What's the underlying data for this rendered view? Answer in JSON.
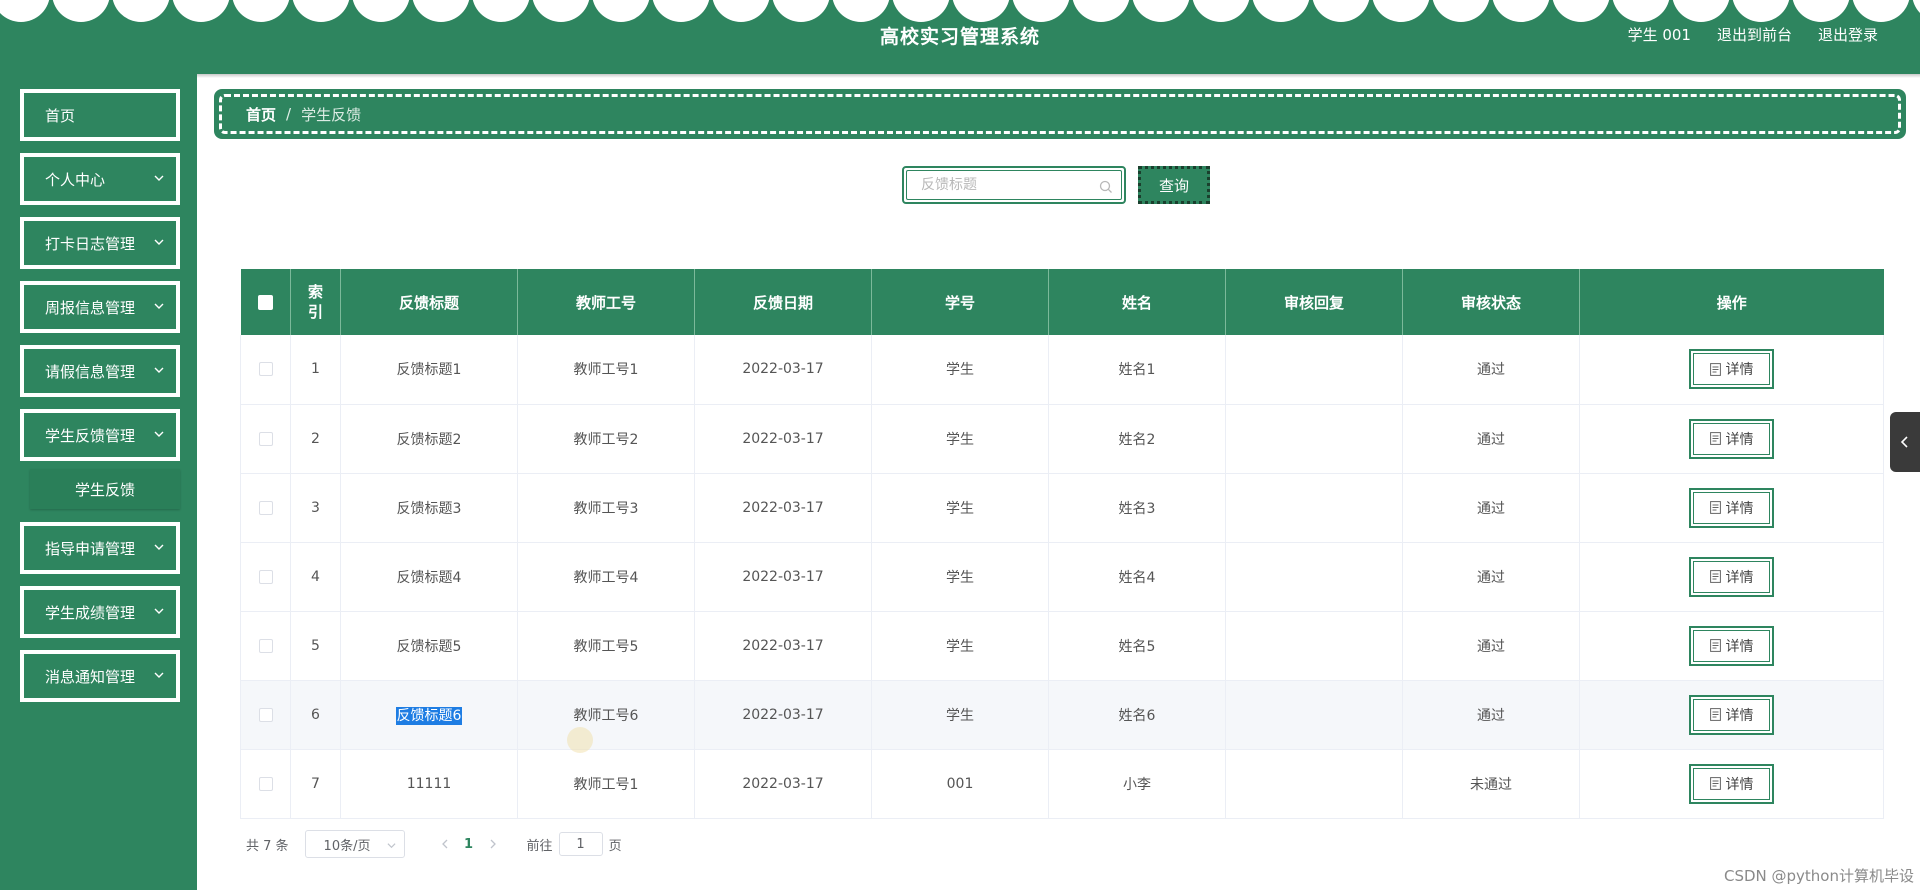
{
  "header": {
    "title": "高校实习管理系统",
    "user": "学生 001",
    "front_link": "退出到前台",
    "logout": "退出登录"
  },
  "sidebar": {
    "items": [
      {
        "label": "首页"
      },
      {
        "label": "个人中心"
      },
      {
        "label": "打卡日志管理"
      },
      {
        "label": "周报信息管理"
      },
      {
        "label": "请假信息管理"
      },
      {
        "label": "学生反馈管理"
      },
      {
        "label": "指导申请管理"
      },
      {
        "label": "学生成绩管理"
      },
      {
        "label": "消息通知管理"
      }
    ],
    "submenu": "学生反馈"
  },
  "breadcrumb": {
    "home": "首页",
    "separator": "/",
    "current": "学生反馈"
  },
  "search": {
    "placeholder": "反馈标题",
    "button": "查询"
  },
  "table": {
    "headers": [
      "索引",
      "反馈标题",
      "教师工号",
      "反馈日期",
      "学号",
      "姓名",
      "审核回复",
      "审核状态",
      "操作"
    ],
    "rows": [
      {
        "idx": "1",
        "title": "反馈标题1",
        "teacher": "教师工号1",
        "date": "2022-03-17",
        "sid": "学生",
        "name": "姓名1",
        "reply": "",
        "status": "通过",
        "action": "详情"
      },
      {
        "idx": "2",
        "title": "反馈标题2",
        "teacher": "教师工号2",
        "date": "2022-03-17",
        "sid": "学生",
        "name": "姓名2",
        "reply": "",
        "status": "通过",
        "action": "详情"
      },
      {
        "idx": "3",
        "title": "反馈标题3",
        "teacher": "教师工号3",
        "date": "2022-03-17",
        "sid": "学生",
        "name": "姓名3",
        "reply": "",
        "status": "通过",
        "action": "详情"
      },
      {
        "idx": "4",
        "title": "反馈标题4",
        "teacher": "教师工号4",
        "date": "2022-03-17",
        "sid": "学生",
        "name": "姓名4",
        "reply": "",
        "status": "通过",
        "action": "详情"
      },
      {
        "idx": "5",
        "title": "反馈标题5",
        "teacher": "教师工号5",
        "date": "2022-03-17",
        "sid": "学生",
        "name": "姓名5",
        "reply": "",
        "status": "通过",
        "action": "详情"
      },
      {
        "idx": "6",
        "title": "反馈标题6",
        "teacher": "教师工号6",
        "date": "2022-03-17",
        "sid": "学生",
        "name": "姓名6",
        "reply": "",
        "status": "通过",
        "action": "详情"
      },
      {
        "idx": "7",
        "title": "11111",
        "teacher": "教师工号1",
        "date": "2022-03-17",
        "sid": "001",
        "name": "小李",
        "reply": "",
        "status": "未通过",
        "action": "详情"
      }
    ]
  },
  "pagination": {
    "total": "共 7 条",
    "page_size": "10条/页",
    "current_page": "1",
    "goto_label": "前往",
    "goto_value": "1",
    "page_suffix": "页"
  },
  "watermark": "CSDN @python计算机毕设",
  "colors": {
    "primary": "#2e855f",
    "selection": "#1e7de3"
  },
  "icons": {
    "menu_chevron": "chevron-down-icon",
    "search": "search-icon",
    "detail": "document-icon",
    "side_toggle": "chevron-left-icon"
  }
}
